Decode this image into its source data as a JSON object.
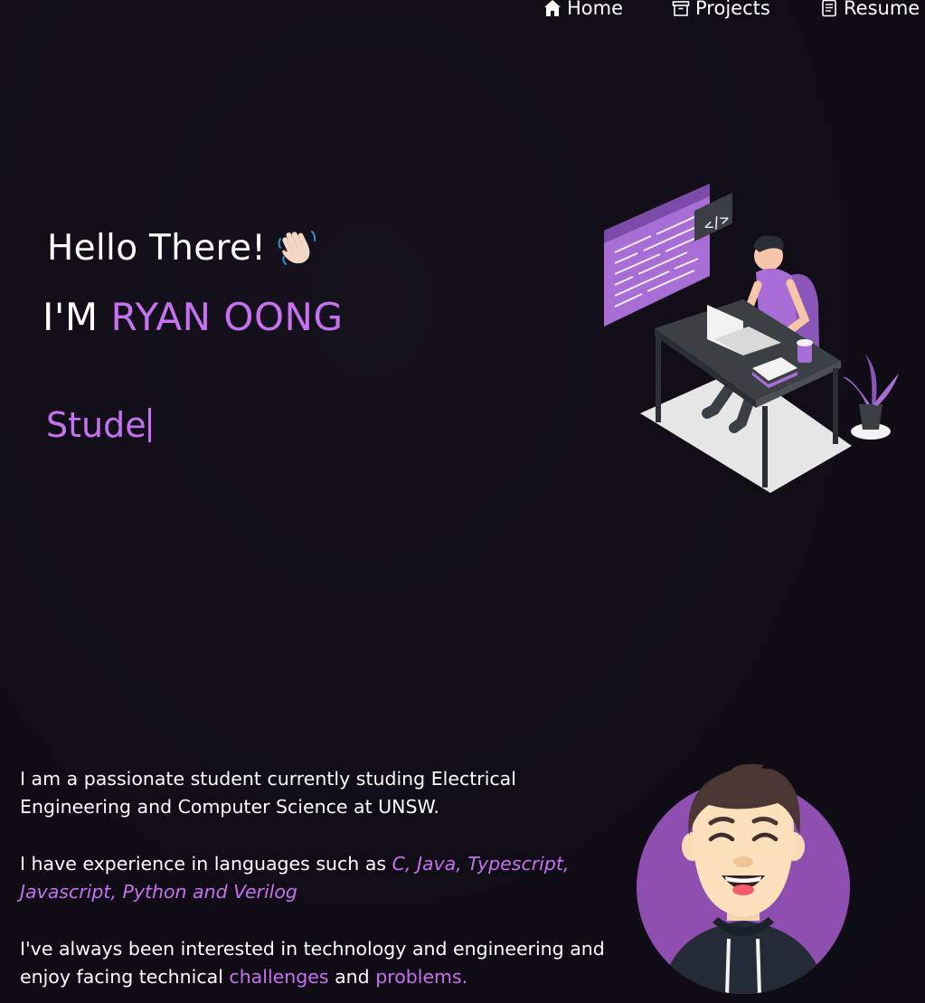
{
  "nav": {
    "items": [
      {
        "label": "Home",
        "icon": "home-icon"
      },
      {
        "label": "Projects",
        "icon": "archive-icon"
      },
      {
        "label": "Resume",
        "icon": "document-icon"
      }
    ]
  },
  "hero": {
    "greeting": "Hello There!",
    "greeting_emoji": "waving-hand-icon",
    "intro_prefix": "I'M",
    "name": "RYAN OONG",
    "typed_text": "Stude"
  },
  "about": {
    "p1": "I am a passionate student currently studing Electrical Engineering and Computer Science at UNSW.",
    "p2_prefix": "I have experience in languages such as",
    "p2_languages": "C, Java, Typescript, Javascript, Python and Verilog",
    "p3_prefix": "I've always been interested in technology and engineering and enjoy facing technical",
    "p3_word1": "challenges",
    "p3_and": "and",
    "p3_word2": "problems."
  },
  "colors": {
    "background": "#100d17",
    "accent": "#c770f0",
    "text": "#ffffff"
  }
}
